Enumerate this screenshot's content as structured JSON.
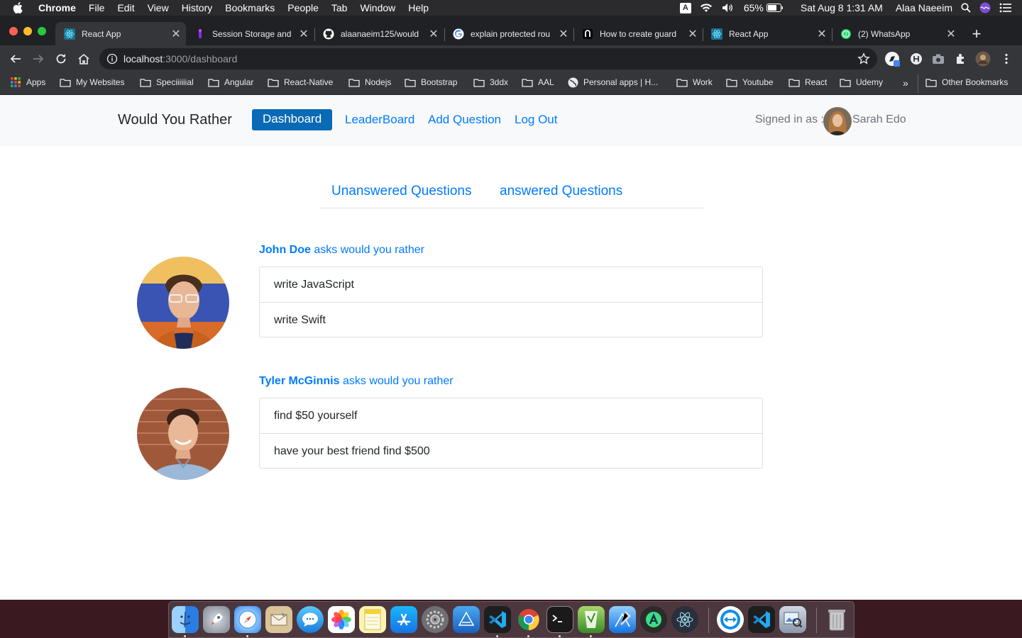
{
  "menubar": {
    "app_name": "Chrome",
    "items": [
      "File",
      "Edit",
      "View",
      "History",
      "Bookmarks",
      "People",
      "Tab",
      "Window",
      "Help"
    ],
    "input_source": "A",
    "battery": "65%",
    "datetime": "Sat Aug 8  1:31 AM",
    "user": "Alaa Naeeim"
  },
  "tabs": [
    {
      "title": "React App",
      "favicon": "react-icon",
      "active": true
    },
    {
      "title": "Session Storage and",
      "favicon": "ionic-icon"
    },
    {
      "title": "alaanaeim125/would",
      "favicon": "github-icon"
    },
    {
      "title": "explain protected rou",
      "favicon": "google-icon"
    },
    {
      "title": "How to create guard",
      "favicon": "notion-icon"
    },
    {
      "title": "React App",
      "favicon": "react-icon"
    },
    {
      "title": "(2) WhatsApp",
      "favicon": "whatsapp-icon"
    }
  ],
  "address_bar": {
    "host": "localhost",
    "path": ":3000/dashboard"
  },
  "bookmarks": [
    {
      "label": "Apps",
      "icon": "apps-grid-icon"
    },
    {
      "label": "My Websites",
      "icon": "folder-icon"
    },
    {
      "label": "Speciiiiiial",
      "icon": "folder-icon"
    },
    {
      "label": "Angular",
      "icon": "folder-icon"
    },
    {
      "label": "React-Native",
      "icon": "folder-icon"
    },
    {
      "label": "Nodejs",
      "icon": "folder-icon"
    },
    {
      "label": "Bootstrap",
      "icon": "folder-icon"
    },
    {
      "label": "3ddx",
      "icon": "folder-icon"
    },
    {
      "label": "AAL",
      "icon": "folder-icon"
    },
    {
      "label": "Personal apps | H...",
      "icon": "globe-icon"
    },
    {
      "label": "Work",
      "icon": "folder-icon"
    },
    {
      "label": "Youtube",
      "icon": "folder-icon"
    },
    {
      "label": "React",
      "icon": "folder-icon"
    },
    {
      "label": "Udemy",
      "icon": "folder-icon"
    }
  ],
  "bookmarks_overflow": "»",
  "other_bookmarks": "Other Bookmarks",
  "app": {
    "brand": "Would You Rather",
    "nav": {
      "dashboard": "Dashboard",
      "leaderboard": "LeaderBoard",
      "add_question": "Add Question",
      "logout": "Log Out"
    },
    "signed_in_label": "Signed in as :",
    "user_name": "Sarah Edo",
    "question_tabs": {
      "unanswered": "Unanswered Questions",
      "answered": "answered Questions"
    },
    "asks_suffix": "asks would you rather",
    "questions": [
      {
        "author": "John Doe",
        "option_one": "write JavaScript",
        "option_two": "write Swift"
      },
      {
        "author": "Tyler McGinnis",
        "option_one": "find $50 yourself",
        "option_two": "have your best friend find $500"
      }
    ]
  },
  "colors": {
    "primary": "#007bff",
    "active_nav": "#0a6ab5",
    "navbar_bg": "#f8f9fa"
  }
}
